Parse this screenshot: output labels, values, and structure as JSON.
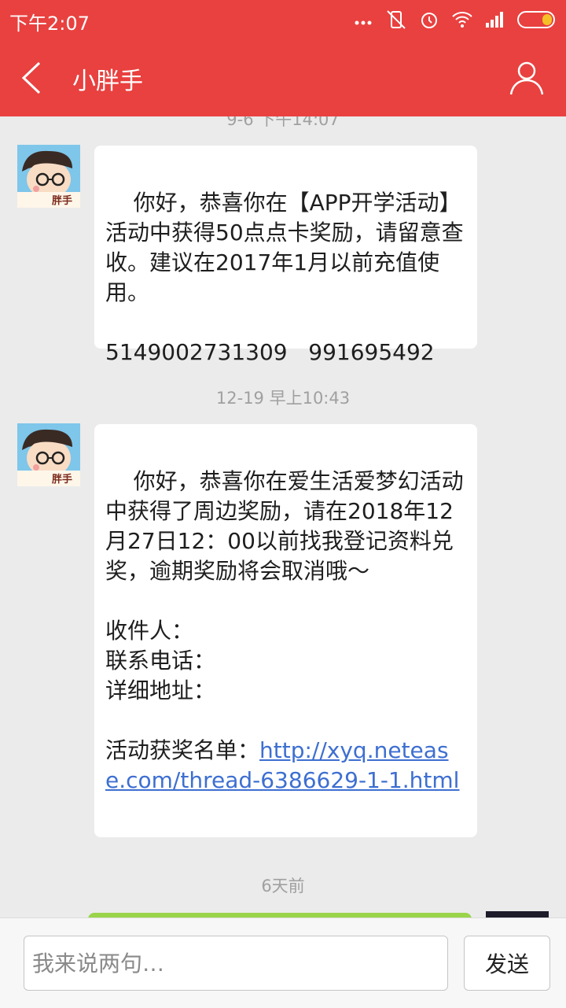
{
  "statusbar": {
    "time": "下午2:07",
    "icons": [
      "more-icon",
      "mute-vibrate-icon",
      "alarm-icon",
      "wifi-icon",
      "signal-icon",
      "battery-icon"
    ]
  },
  "header": {
    "title": "小胖手"
  },
  "messages": [
    {
      "timestamp": "9-6 下午14:07",
      "avatar_text": "胖手",
      "text": "你好，恭喜你在【APP开学活动】活动中获得50点点卡奖励，请留意查收。建议在2017年1月以前充值使用。\n\n5149002731309   991695492"
    },
    {
      "timestamp": "12-19 早上10:43",
      "avatar_text": "胖手",
      "text": "你好，恭喜你在爱生活爱梦幻活动中获得了周边奖励，请在2018年12月27日12：00以前找我登记资料兑奖，逾期奖励将会取消哦～\n\n收件人：\n联系电话：\n详细地址：\n\n活动获奖名单：",
      "link": "http://xyq.netease.com/thread-6386629-1-1.html"
    }
  ],
  "timestamp3": "6天前",
  "input": {
    "placeholder": "我来说两句…",
    "value": ""
  },
  "send_label": "发送",
  "colors": {
    "header": "#e8413f",
    "background": "#ebebeb",
    "link": "#3d6fd1",
    "self_bubble": "#9ad44a"
  }
}
